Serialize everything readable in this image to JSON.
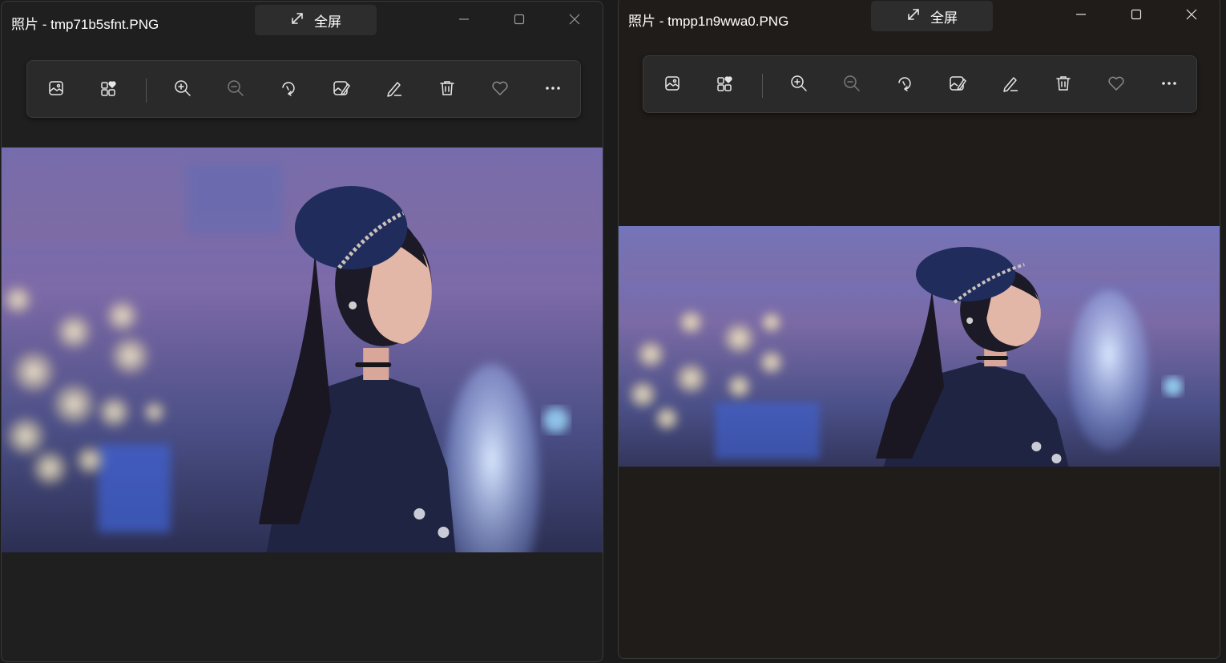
{
  "windows": [
    {
      "title": "照片 - tmp71b5sfnt.PNG",
      "fullscreen_label": "全屏"
    },
    {
      "title": "照片 - tmpp1n9wwa0.PNG",
      "fullscreen_label": "全屏"
    }
  ],
  "toolbar_icons": [
    "image-gallery-icon",
    "collection-favorite-icon",
    "zoom-in-icon",
    "zoom-out-icon",
    "rotate-icon",
    "edit-image-icon",
    "draw-icon",
    "delete-icon",
    "favorite-heart-icon",
    "more-options-icon"
  ],
  "window_controls": [
    "minimize-icon",
    "maximize-icon",
    "close-icon"
  ],
  "colors": {
    "window1_bg": "#1f1f1f",
    "window2_bg": "#201c19",
    "toolbar_bg": "#2a2a2a",
    "icon": "#e6e6e6",
    "icon_disabled": "#7a7a7a"
  }
}
